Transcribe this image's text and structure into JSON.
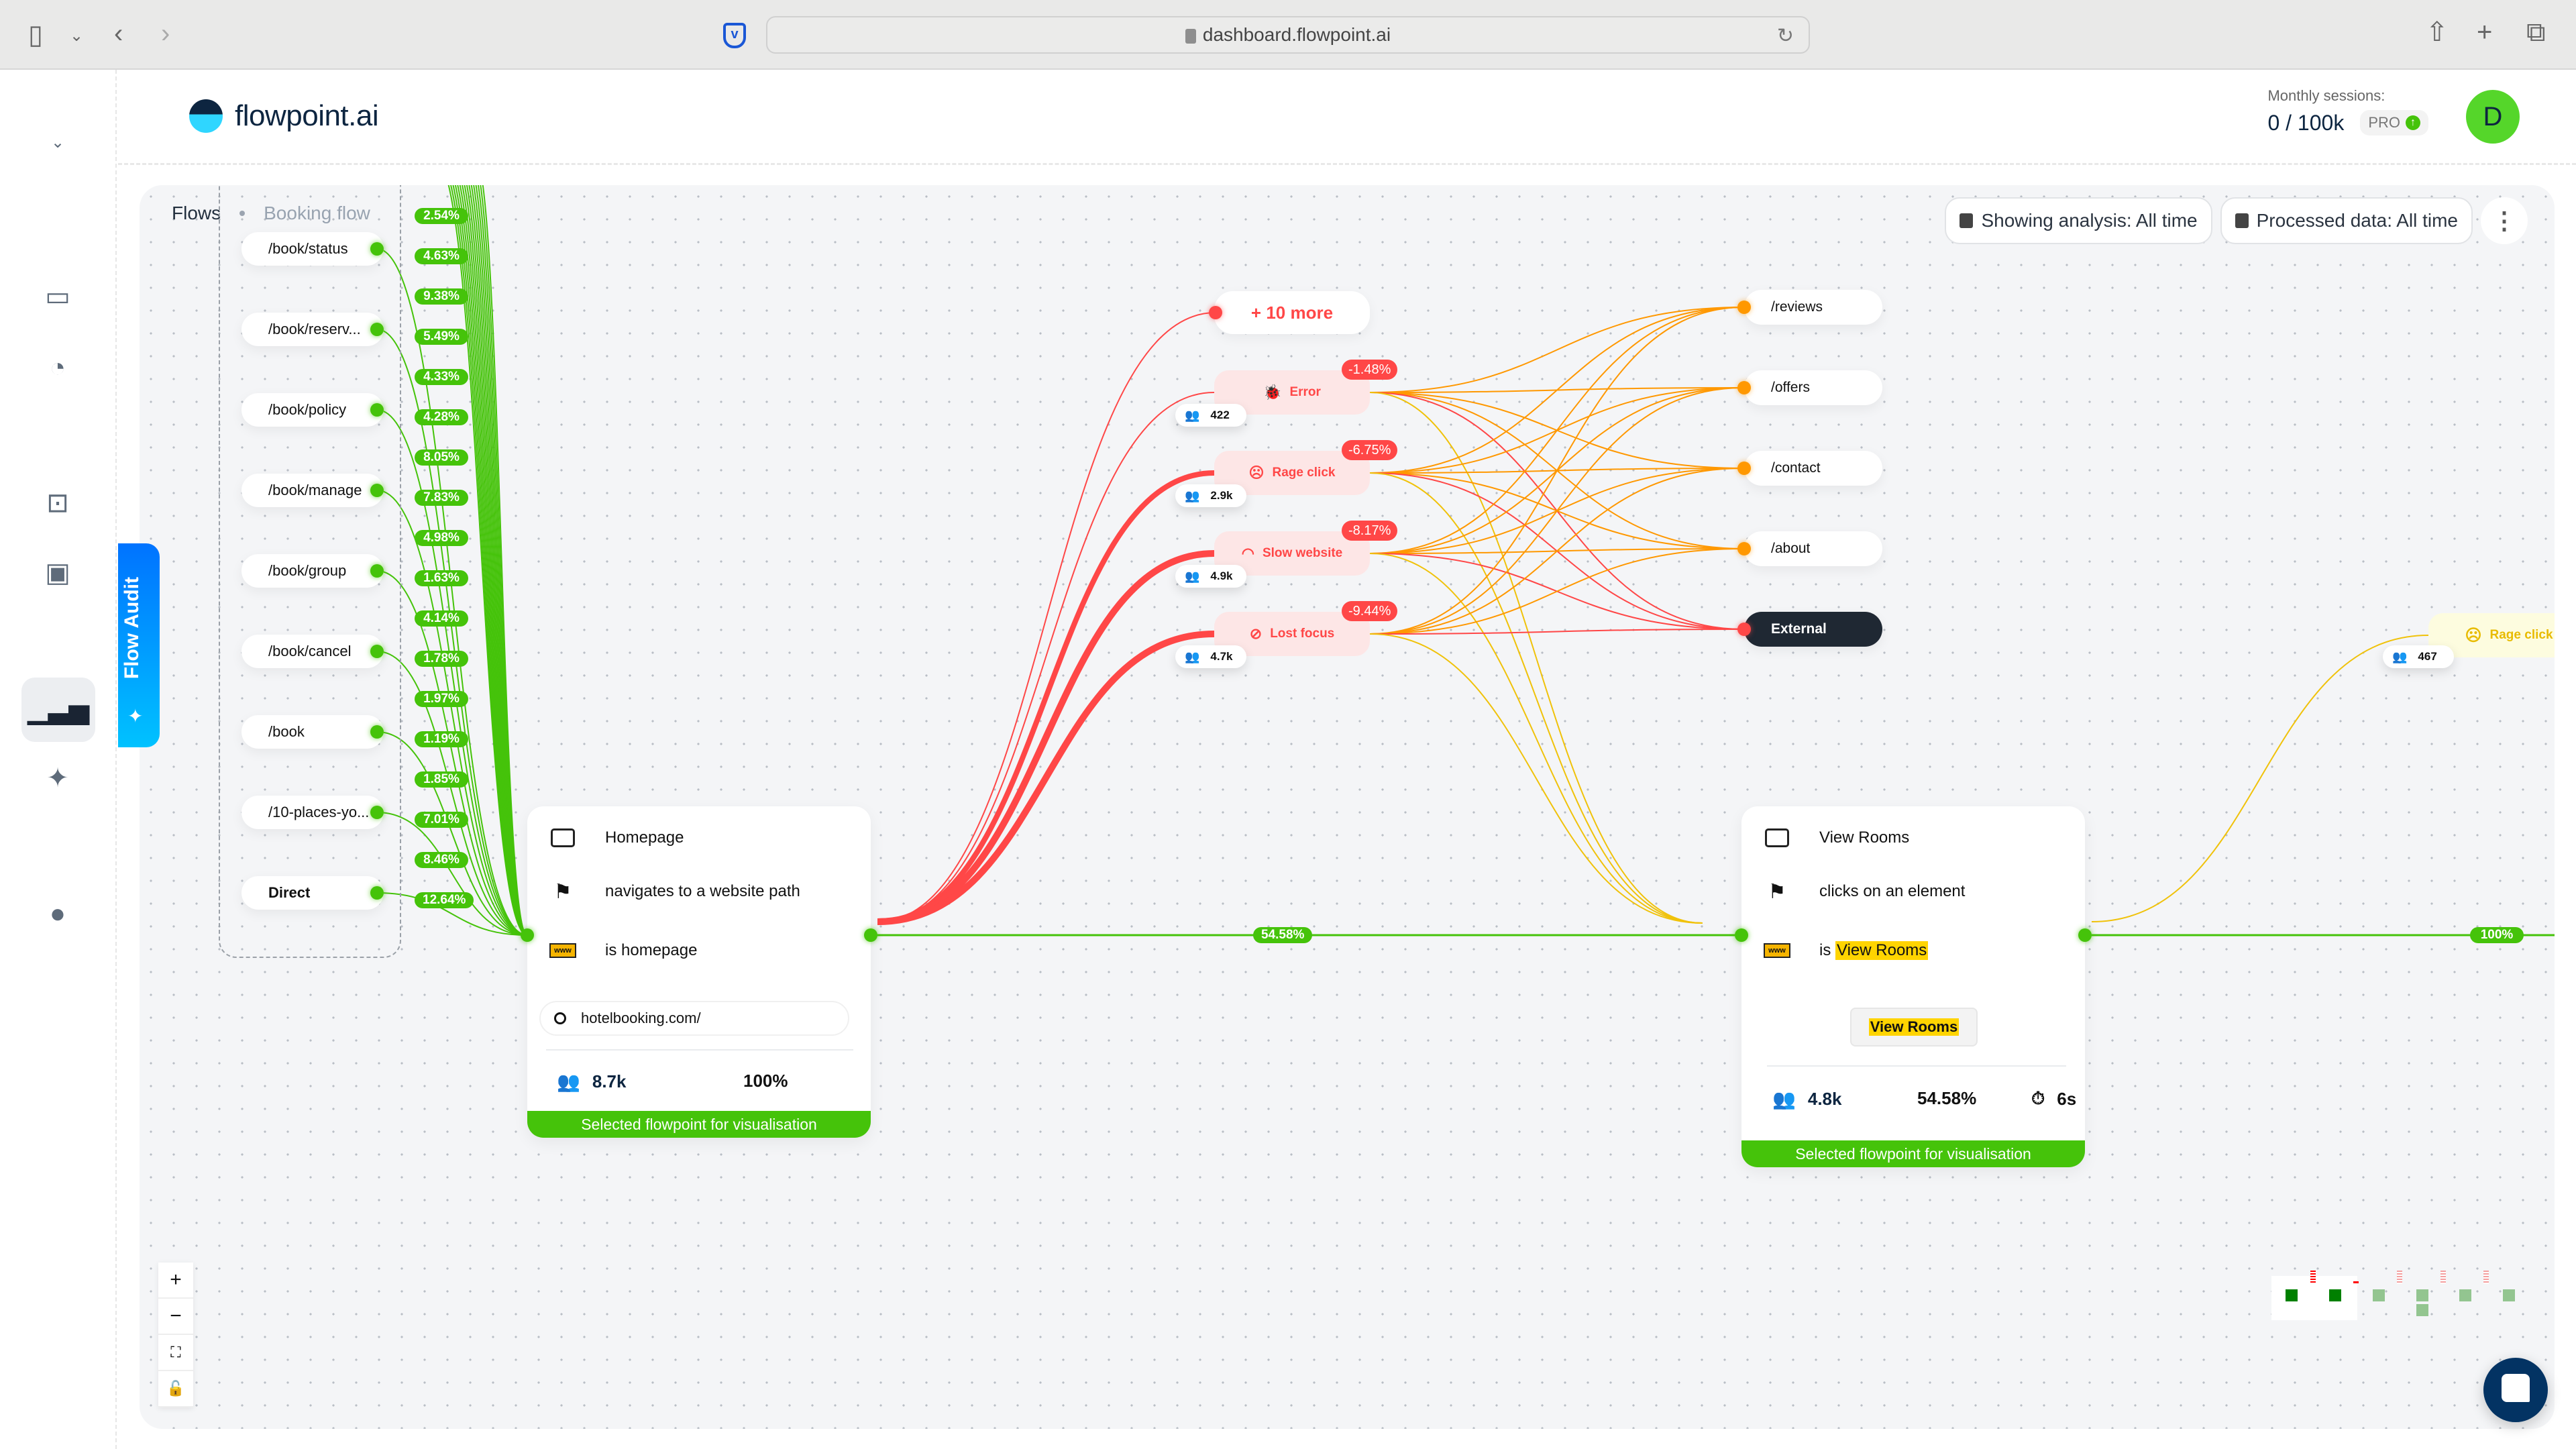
{
  "browser": {
    "url": "dashboard.flowpoint.ai",
    "icons": [
      "sidebar-toggle-icon",
      "chevron-down-icon",
      "back-icon",
      "forward-icon",
      "pocket-icon",
      "lock-icon",
      "reload-icon",
      "share-icon",
      "new-tab-icon",
      "tabs-overview-icon"
    ]
  },
  "app": {
    "logo_text": "flowpoint.ai",
    "sessions_label": "Monthly sessions:",
    "sessions_value": "0 / 100k",
    "plan_badge": "PRO",
    "avatar_initial": "D"
  },
  "sidebar": {
    "items": [
      {
        "name": "sessions",
        "icon": "monitor-icon"
      },
      {
        "name": "reports",
        "icon": "pie-chart-icon"
      },
      {
        "name": "ai-assistant",
        "icon": "robot-icon"
      },
      {
        "name": "scheduled",
        "icon": "calendar-check-icon"
      },
      {
        "name": "funnels",
        "icon": "chart-trend-icon",
        "active": true
      },
      {
        "name": "insights",
        "icon": "sparkles-icon"
      },
      {
        "name": "account",
        "icon": "user-icon"
      }
    ],
    "flow_audit_label": "Flow Audit"
  },
  "toolbar": {
    "breadcrumb": [
      "Flows",
      "Booking flow"
    ],
    "analysis_button": "Showing analysis: All time",
    "processed_button": "Processed data: All time"
  },
  "sources": [
    {
      "label": "/book/status"
    },
    {
      "label": "/book/reserv..."
    },
    {
      "label": "/book/policy"
    },
    {
      "label": "/book/manage"
    },
    {
      "label": "/book/group"
    },
    {
      "label": "/book/cancel"
    },
    {
      "label": "/book"
    },
    {
      "label": "/10-places-yo..."
    },
    {
      "label": "Direct",
      "bold": true
    }
  ],
  "source_percentages": [
    "7.83%",
    "2.54%",
    "4.63%",
    "9.38%",
    "5.49%",
    "4.33%",
    "4.28%",
    "8.05%",
    "7.83%",
    "4.98%",
    "1.63%",
    "4.14%",
    "1.78%",
    "1.97%",
    "1.19%",
    "1.85%",
    "7.01%",
    "8.46%",
    "12.64%"
  ],
  "homepage_card": {
    "title": "Homepage",
    "action": "navigates to a website path",
    "condition": "is homepage",
    "url_value": "hotelbooking.com/",
    "users": "8.7k",
    "percent": "100%",
    "banner": "Selected flowpoint for visualisation"
  },
  "main_edge_percent": "54.58%",
  "more_pill": "+ 10 more",
  "frictions": [
    {
      "label": "Error",
      "icon": "bug-icon",
      "delta": "-1.48%",
      "users": "422"
    },
    {
      "label": "Rage click",
      "icon": "angry-face-icon",
      "delta": "-6.75%",
      "users": "2.9k"
    },
    {
      "label": "Slow website",
      "icon": "speedometer-icon",
      "delta": "-8.17%",
      "users": "4.9k"
    },
    {
      "label": "Lost focus",
      "icon": "eye-off-icon",
      "delta": "-9.44%",
      "users": "4.7k"
    }
  ],
  "destinations": [
    {
      "label": "/reviews"
    },
    {
      "label": "/offers"
    },
    {
      "label": "/contact"
    },
    {
      "label": "/about"
    },
    {
      "label": "External",
      "dark": true
    }
  ],
  "view_rooms_card": {
    "title": "View Rooms",
    "action": "clicks on an element",
    "condition_prefix": "is",
    "condition_value": "View Rooms",
    "element_preview": "View Rooms",
    "users": "4.8k",
    "percent": "54.58%",
    "time": "6s",
    "banner": "Selected flowpoint for visualisation"
  },
  "next_friction": {
    "label": "Rage click",
    "users": "467"
  },
  "next_edge_percent": "100%",
  "colors": {
    "green": "#45c30a",
    "red": "#ff4747",
    "orange": "#ff9800",
    "yellow": "#f0c20a",
    "dark": "#1f2833",
    "brand_blue": "#0073ff"
  }
}
